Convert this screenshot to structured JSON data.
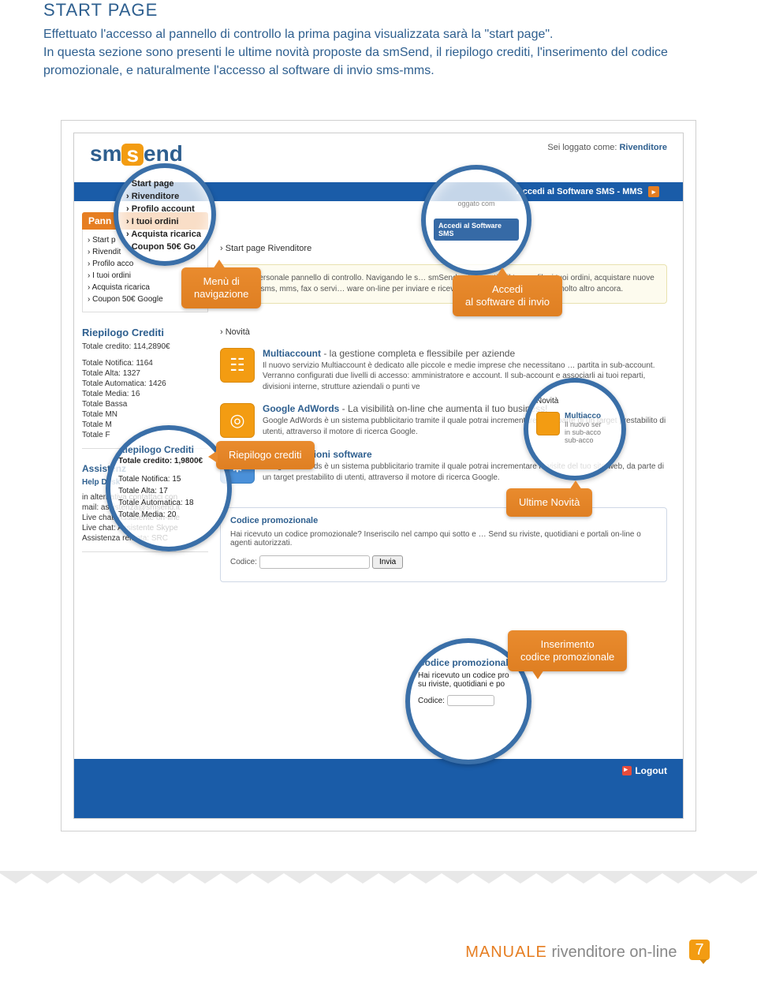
{
  "intro": {
    "title": "START PAGE",
    "p1": "Effettuato l'accesso al pannello di controllo la prima pagina visualizzata sarà la \"start page\".",
    "p2": "In questa sezione sono presenti le ultime novità proposte da smSend, il riepilogo crediti, l'inserimento del codice promozionale, e naturalmente l'accesso al software di invio sms-mms."
  },
  "logo": {
    "pre": "sm",
    "mid": "s",
    "post": "end"
  },
  "loggedAs": {
    "label": "Sei loggato come:",
    "user": "Rivenditore"
  },
  "bluebar": {
    "sw": "Accedi al Software SMS - MMS"
  },
  "panel": {
    "title": "Pann",
    "items": [
      "Start p",
      "Rivendit",
      "Profilo acco",
      "I tuoi ordini",
      "Acquista ricarica",
      "Coupon 50€ Google"
    ]
  },
  "credits": {
    "title": "Riepilogo Crediti",
    "total": "Totale credito: 114,2890€",
    "rows": [
      "Totale Notifica: 1164",
      "Totale Alta: 1327",
      "Totale Automatica: 1426",
      "Totale Media: 16",
      "Totale Bassa",
      "Totale MN",
      "Totale M",
      "Totale F"
    ]
  },
  "assist": {
    "title": "Assistenz",
    "sub": "Help Desk",
    "lines": [
      "in alternativa contattaci con",
      "mail: assistenza@smsend.it",
      "Live chat: Assistente on-line",
      "Live chat: Assistente Skype",
      "Assistenza remota: SRC"
    ]
  },
  "crumb": "Start page Rivenditore",
  "welcome": "del tuo personale pannello di controllo. Navigando le s… smSend potrai gestire il tuo profilo, i tuoi ordini, acquistare nuove ricariche sms, mms, fax o servi… ware on-line per inviare e ricevere sms, mms, fax o m.n.c. e molto altro ancora.",
  "news": {
    "heading": "Novità",
    "items": [
      {
        "title": "Multiaccount",
        "tag": " - la gestione completa e flessibile per aziende",
        "desc": "Il nuovo servizio Multiaccount è dedicato alle piccole e medie imprese che necessitano … partita in sub-account. Verranno configurati due livelli di accesso: amministratore e account. Il sub-account e associarli ai tuoi reparti, divisioni interne, strutture aziendali o punti ve"
      },
      {
        "title": "Google AdWords",
        "tag": " - La visibilità on-line che aumenta il tuo business!",
        "desc": "Google AdWords è un sistema pubblicitario tramite il quale potrai incrementare … la parte di un target prestabilito di utenti, attraverso il motore di ricerca Google."
      },
      {
        "title": "Nuove funzioni software",
        "tag": "",
        "desc": "Google AdWords è un sistema pubblicitario tramite il quale potrai incrementare le visite del tuo sito web, da parte di un target prestabilito di utenti, attraverso il motore di ricerca Google."
      }
    ]
  },
  "promo": {
    "title": "Codice promozionale",
    "desc": "Hai ricevuto un codice promozionale? Inseriscilo nel campo qui sotto e … Send su riviste, quotidiani e portali on-line o agenti autorizzati.",
    "label": "Codice:",
    "btn": "Invia"
  },
  "logout": "Logout",
  "lenses": {
    "menu": [
      "Start page",
      "Rivenditore",
      "Profilo account",
      "I tuoi ordini",
      "Acquista ricarica",
      "Coupon 50€ Go"
    ],
    "swTop": "oggato com",
    "swBtn": "Accedi al Software SMS",
    "cred": {
      "title": "Riepilogo Crediti",
      "total": "Totale credito: 1,9800€",
      "rows": [
        "Totale Notifica: 15",
        "Totale Alta: 17",
        "Totale Automatica: 18",
        "Totale Media: 20"
      ]
    },
    "nov": {
      "crumb": "Novità",
      "title": "Multiacco",
      "lines": [
        "Il nuovo ser",
        "in sub-acco",
        "sub-acco"
      ]
    },
    "promo": {
      "title": "Codice promozionale",
      "p": "Hai ricevuto un codice pro su riviste, quotidiani e po",
      "label": "Codice:"
    }
  },
  "bubbles": {
    "menu": "Menù di\nnavigazione",
    "sw": "Accedi\nal software di invio",
    "cred": "Riepilogo crediti",
    "nov": "Ultime Novità",
    "promo": "Inserimento\ncodice promozionale"
  },
  "footer": {
    "m1": "MANUALE",
    "m2": " rivenditore on-line",
    "page": "7"
  }
}
